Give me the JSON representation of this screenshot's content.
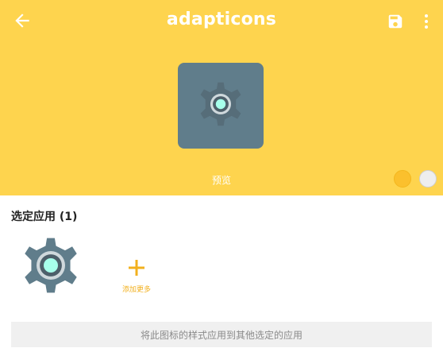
{
  "header": {
    "title": "adapticons",
    "back_icon": "arrow-back-icon",
    "save_icon": "save-icon",
    "more_icon": "more-vert-icon",
    "background_color": "#fed44e"
  },
  "preview": {
    "label": "预览",
    "tile_color": "#607d8b",
    "icon": "settings-gear-icon"
  },
  "swatches": [
    {
      "name": "yellow",
      "color": "#fbc02d"
    },
    {
      "name": "light-gray",
      "color": "#eeeeee"
    }
  ],
  "selected_apps": {
    "title": "选定应用 (1)",
    "items": [
      {
        "icon": "settings-gear-icon"
      }
    ],
    "add_more_label": "添加更多"
  },
  "apply_button": {
    "label": "将此图标的样式应用到其他选定的应用"
  }
}
